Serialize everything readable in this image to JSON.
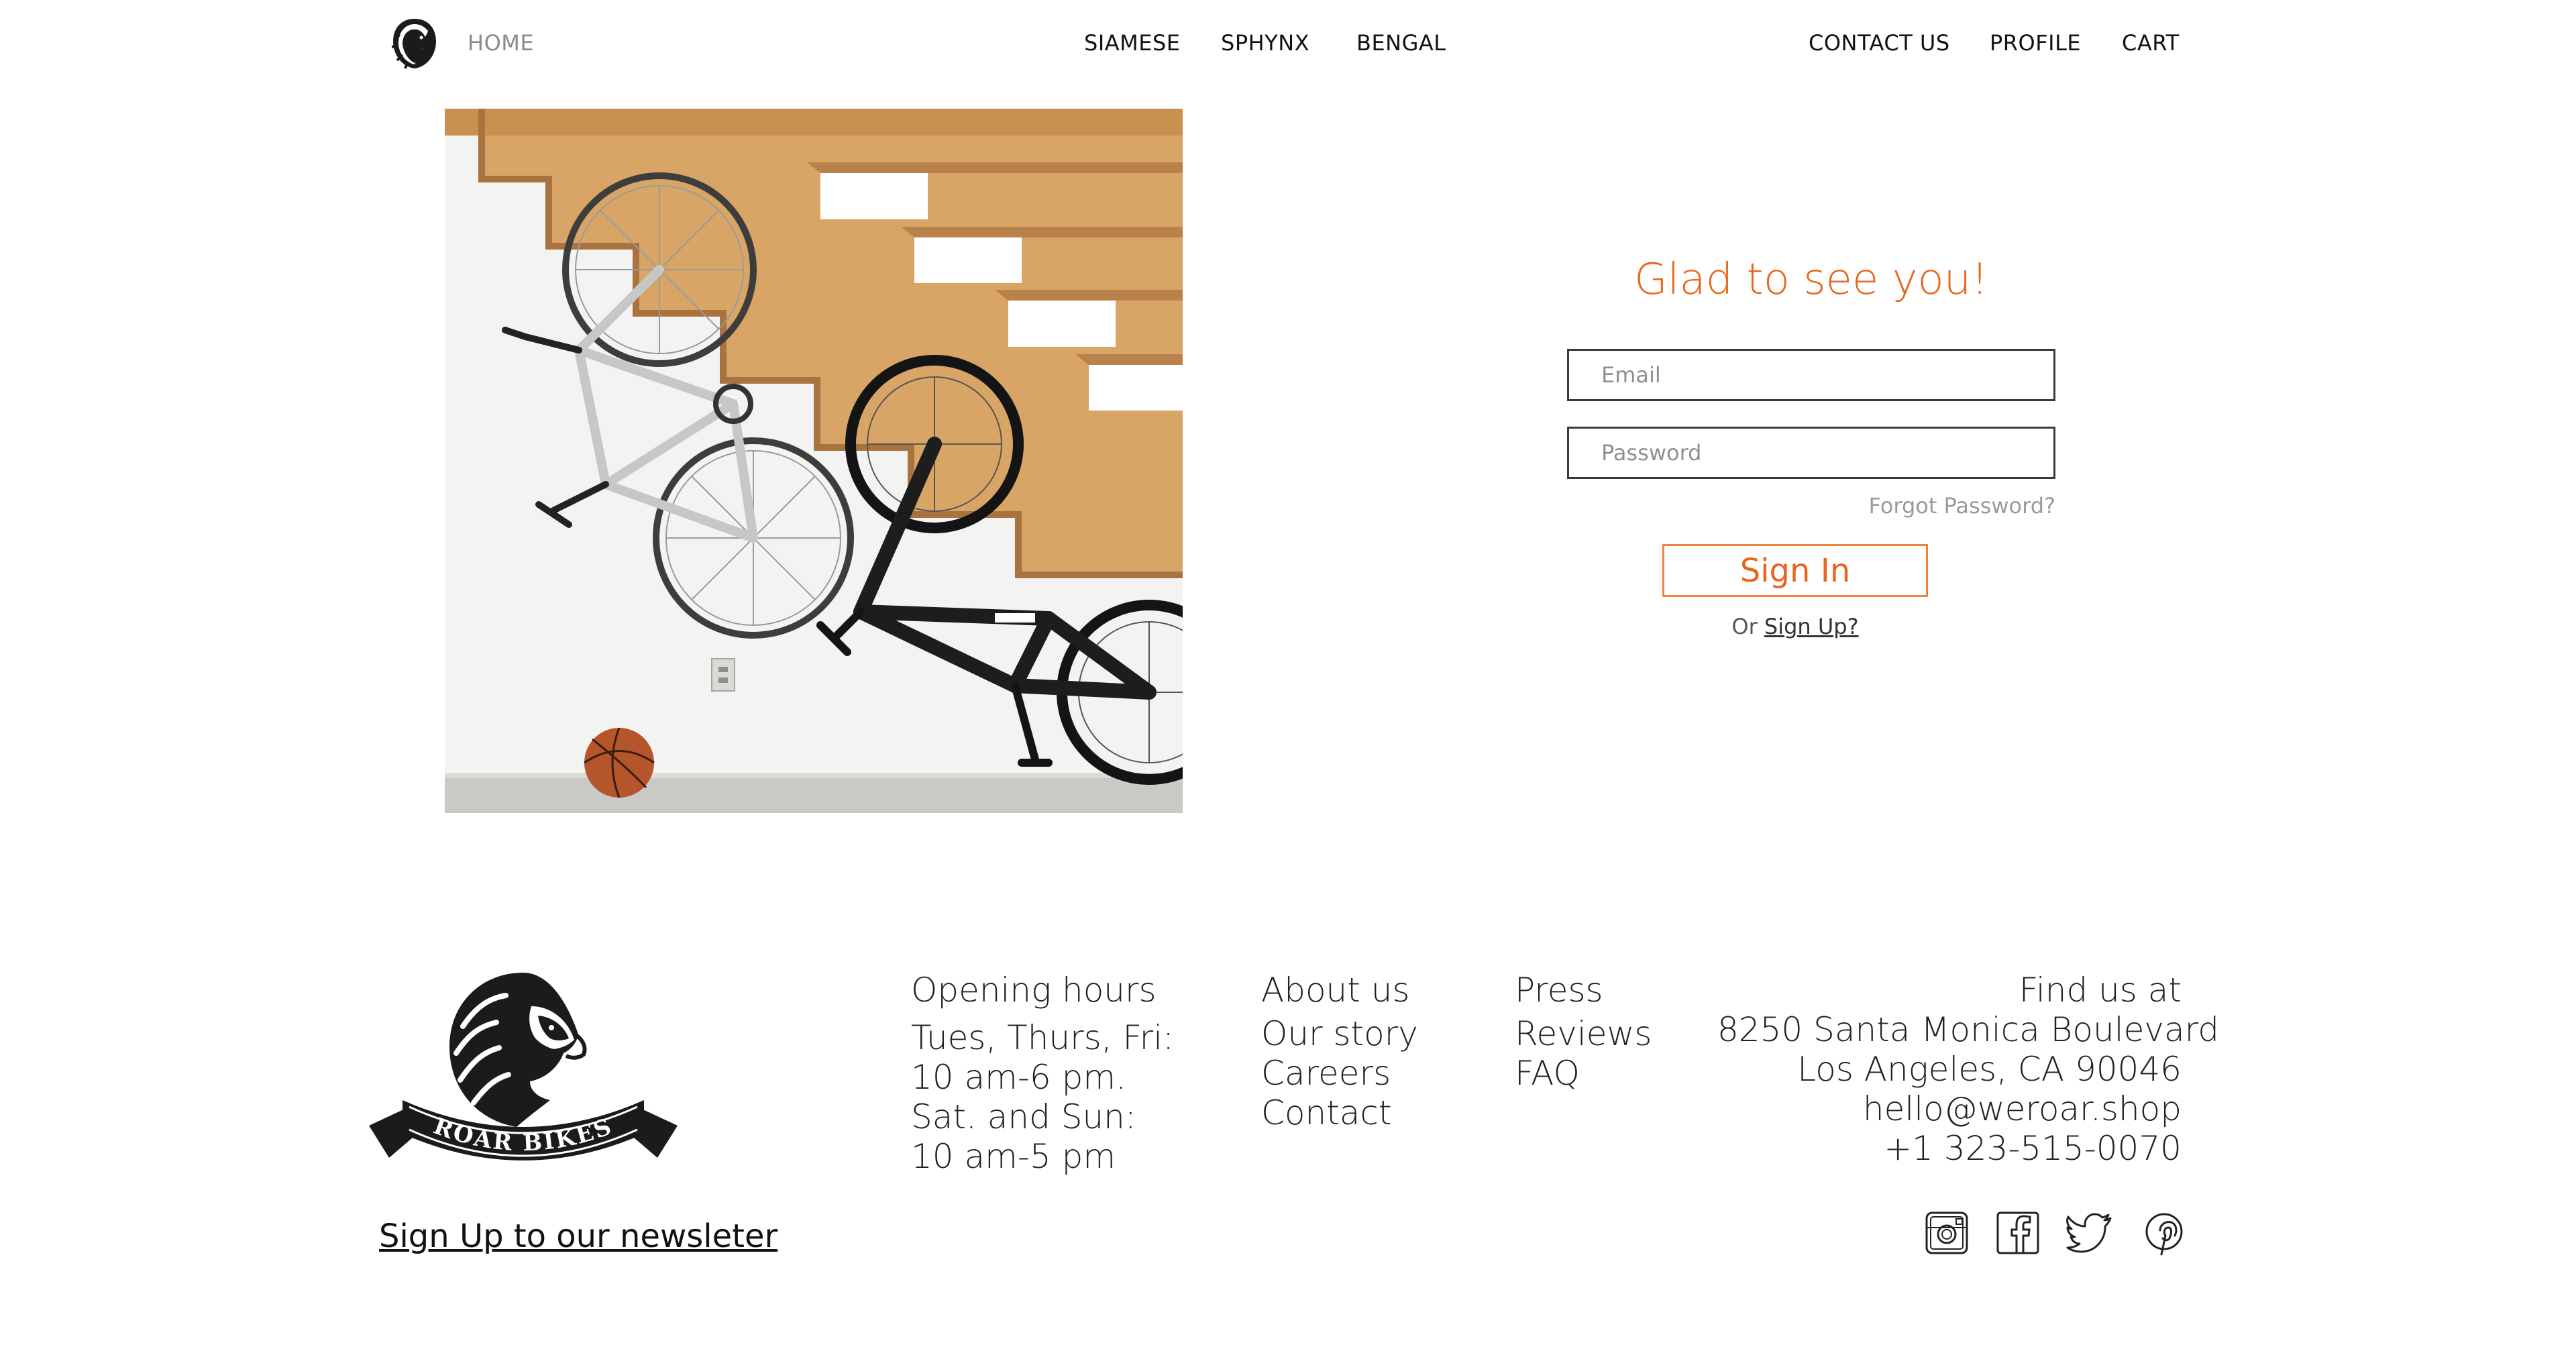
{
  "header": {
    "home": "HOME",
    "center_nav": [
      "SIAMESE",
      "SPHYNX",
      "BENGAL"
    ],
    "right_nav": [
      "CONTACT US",
      "PROFILE",
      "CART"
    ]
  },
  "login": {
    "title": "Glad to see you!",
    "email_placeholder": "Email",
    "password_placeholder": "Password",
    "forgot": "Forgot Password?",
    "signin": "Sign In",
    "or": "Or",
    "signup": "Sign Up?"
  },
  "footer": {
    "logo_text": "ROAR BIKES",
    "newsletter": "Sign Up to our newsleter",
    "hours": {
      "heading": "Opening hours",
      "lines": [
        "Tues, Thurs, Fri:",
        "10 am-6 pm.",
        "Sat. and Sun:",
        "10 am-5 pm"
      ]
    },
    "about": {
      "heading": "About us",
      "links": [
        "Our story",
        "Careers",
        "Contact"
      ]
    },
    "press": {
      "heading": "Press",
      "links": [
        "Reviews",
        "FAQ"
      ]
    },
    "find": {
      "heading": "Find us at",
      "lines": [
        "8250 Santa Monica Boulevard",
        "Los Angeles, CA 90046",
        "hello@weroar.shop",
        "+1 323-515-0070"
      ]
    },
    "social": [
      "instagram-icon",
      "facebook-icon",
      "twitter-icon",
      "pinterest-icon"
    ]
  },
  "colors": {
    "accent": "#e8661c",
    "text": "#111111",
    "muted": "#8a8a8a"
  }
}
